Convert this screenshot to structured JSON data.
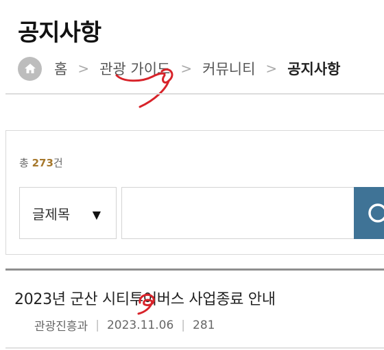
{
  "page": {
    "title": "공지사항"
  },
  "breadcrumb": {
    "items": [
      {
        "label": "홈"
      },
      {
        "label": "관광 가이드"
      },
      {
        "label": "커뮤니티"
      },
      {
        "label": "공지사항"
      }
    ],
    "separator": ">"
  },
  "search": {
    "total_prefix": "총 ",
    "total_count": "273",
    "total_suffix": "건",
    "field_selected": "글제목",
    "field_caret": "▼",
    "keyword_value": ""
  },
  "posts": [
    {
      "title": "2023년 군산 시티투어버스 사업종료 안내",
      "department": "관광진흥과",
      "date": "2023.11.06",
      "views": "281"
    }
  ],
  "colors": {
    "accent": "#3f7396",
    "count": "#a6782c",
    "annotation": "#d8232a"
  }
}
